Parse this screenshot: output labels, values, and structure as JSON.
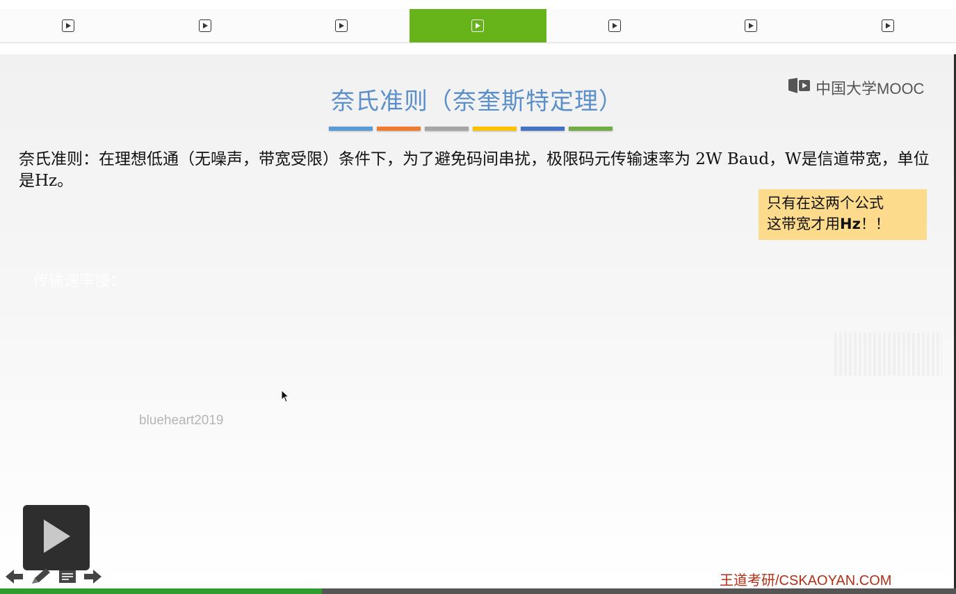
{
  "tabs": [
    {
      "icon": "play-icon",
      "active": false
    },
    {
      "icon": "play-icon",
      "active": false
    },
    {
      "icon": "play-icon",
      "active": false
    },
    {
      "icon": "play-icon",
      "active": true
    },
    {
      "icon": "play-icon",
      "active": false
    },
    {
      "icon": "play-icon",
      "active": false
    },
    {
      "icon": "play-icon",
      "active": false
    }
  ],
  "slide": {
    "logo_text": "中国大学MOOC",
    "title": "奈氏准则（奈奎斯特定理）",
    "title_bar_colors": [
      "#5b9bd5",
      "#ed7d31",
      "#a5a5a5",
      "#ffc000",
      "#4472c4",
      "#70ad47"
    ],
    "body_text": "奈氏准则：在理想低通（无噪声，带宽受限）条件下，为了避免码间串扰，极限码元传输速率为 2W Baud，W是信道带宽，单位是Hz。",
    "note_line1": "只有在这两个公式",
    "note_line2_prefix": "这带宽才用",
    "note_line2_bold": "Hz",
    "note_line2_suffix": "！！",
    "faded_text": "传输速率慢：",
    "watermark": "blueheart2019",
    "footer": "王道考研/CSKAOYAN.COM"
  },
  "player": {
    "progress_fraction": 0.337,
    "colors": {
      "accent": "#66b31a",
      "progress": "#2f9c2f",
      "title": "#5b8fc9",
      "footer": "#b23018",
      "note_bg": "#fddb8c"
    }
  }
}
